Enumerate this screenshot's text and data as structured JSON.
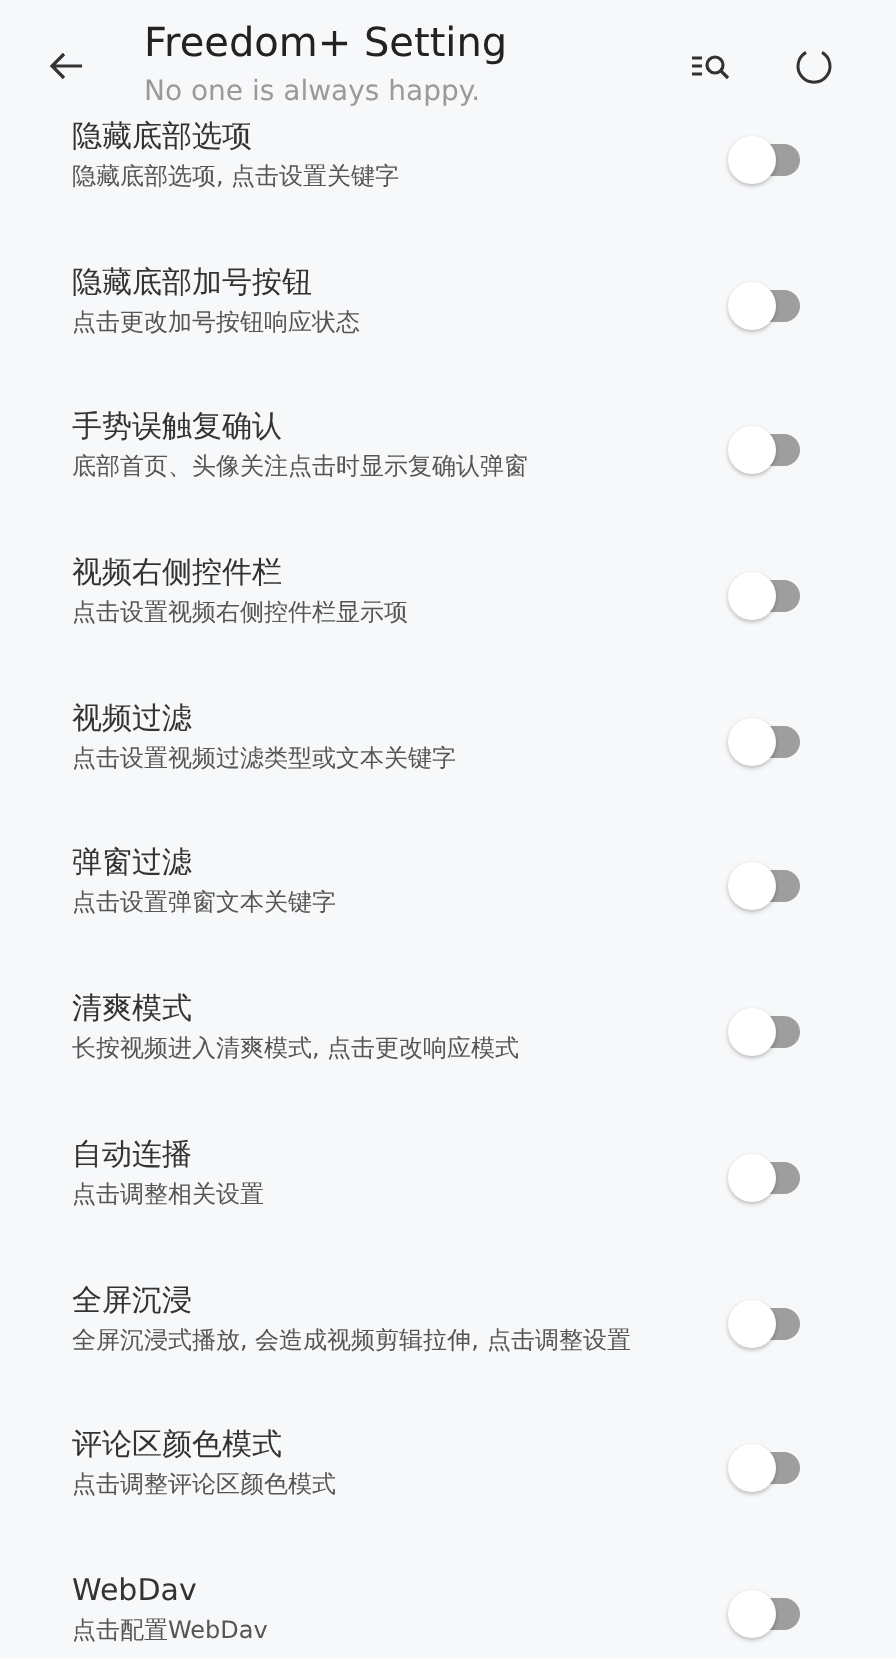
{
  "header": {
    "title": "Freedom+ Setting",
    "subtitle": "No one is always happy."
  },
  "settings": [
    {
      "title": "隐藏底部选项",
      "description": "隐藏底部选项, 点击设置关键字",
      "on": false
    },
    {
      "title": "隐藏底部加号按钮",
      "description": "点击更改加号按钮响应状态",
      "on": false
    },
    {
      "title": "手势误触复确认",
      "description": "底部首页、头像关注点击时显示复确认弹窗",
      "on": false
    },
    {
      "title": "视频右侧控件栏",
      "description": "点击设置视频右侧控件栏显示项",
      "on": false
    },
    {
      "title": "视频过滤",
      "description": "点击设置视频过滤类型或文本关键字",
      "on": false
    },
    {
      "title": "弹窗过滤",
      "description": "点击设置弹窗文本关键字",
      "on": false
    },
    {
      "title": "清爽模式",
      "description": "长按视频进入清爽模式, 点击更改响应模式",
      "on": false
    },
    {
      "title": "自动连播",
      "description": "点击调整相关设置",
      "on": false
    },
    {
      "title": "全屏沉浸",
      "description": "全屏沉浸式播放, 会造成视频剪辑拉伸, 点击调整设置",
      "on": false
    },
    {
      "title": "评论区颜色模式",
      "description": "点击调整评论区颜色模式",
      "on": false
    },
    {
      "title": "WebDav",
      "description": "点击配置WebDav",
      "on": false
    }
  ]
}
